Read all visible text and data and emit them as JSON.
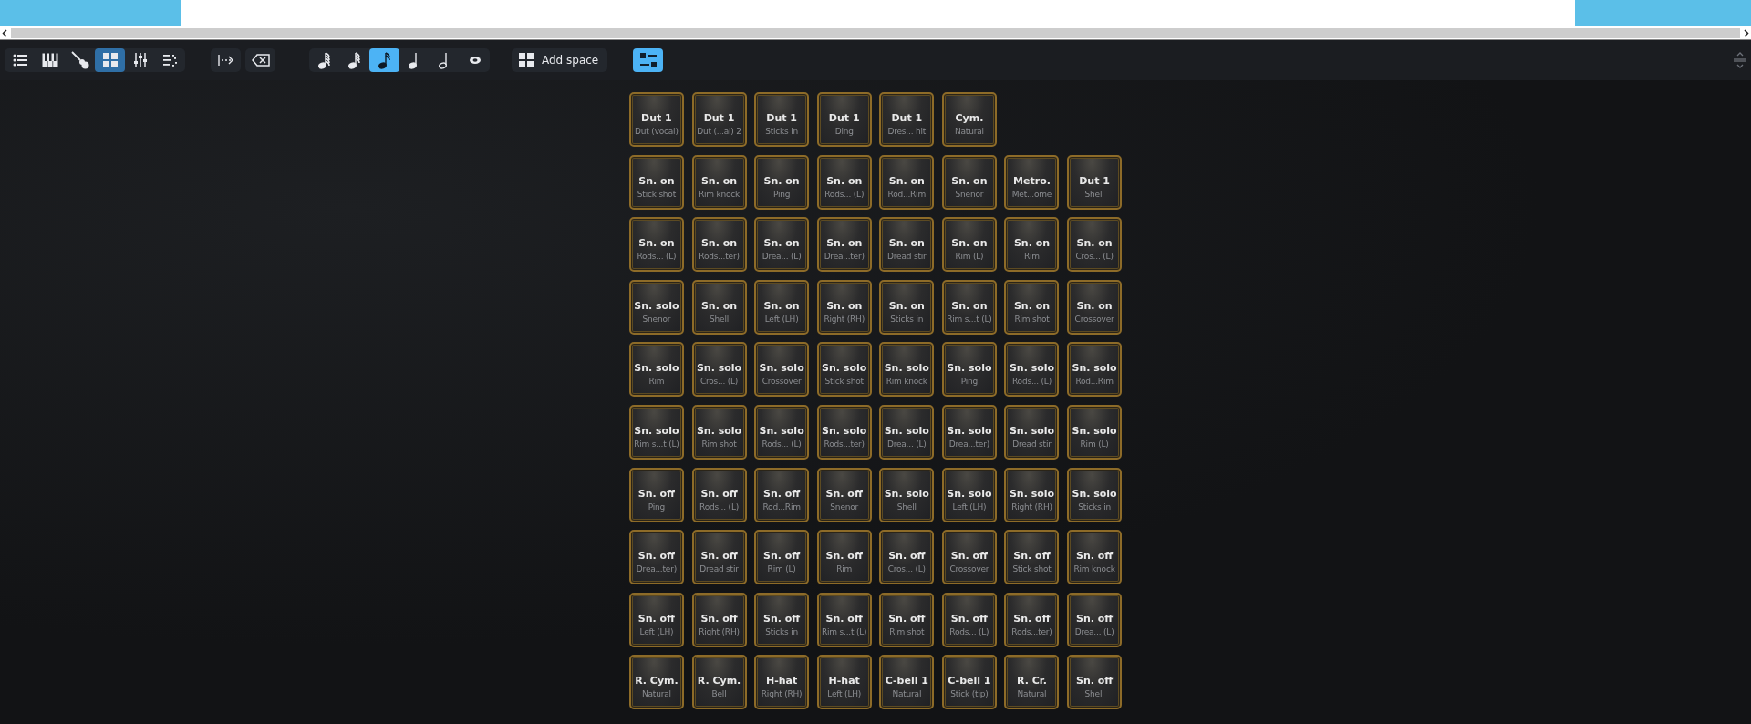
{
  "toolbar": {
    "groups": [
      {
        "items": [
          {
            "kind": "list",
            "selected": false
          },
          {
            "kind": "piano",
            "selected": false
          },
          {
            "kind": "guitar",
            "selected": false
          },
          {
            "kind": "grid",
            "selected": true
          },
          {
            "kind": "mixer",
            "selected": false
          },
          {
            "kind": "tracks",
            "selected": false
          }
        ]
      },
      {
        "items": [
          {
            "kind": "insert",
            "selected": false
          }
        ]
      },
      {
        "items": [
          {
            "kind": "backspace",
            "selected": false
          }
        ]
      },
      {
        "items": [
          {
            "kind": "note64",
            "selected": false
          },
          {
            "kind": "note32",
            "selected": false
          },
          {
            "kind": "note16",
            "selected": true
          },
          {
            "kind": "note8",
            "selected": false
          },
          {
            "kind": "note4",
            "selected": false
          },
          {
            "kind": "note2",
            "selected": false
          }
        ]
      }
    ],
    "add_space": {
      "label": "Add space"
    },
    "toggle": {
      "selected": true
    }
  },
  "pad_rows": [
    [
      {
        "title": "Dut 1",
        "sub": "Dut (vocal)"
      },
      {
        "title": "Dut 1",
        "sub": "Dut (...al) 2"
      },
      {
        "title": "Dut 1",
        "sub": "Sticks in"
      },
      {
        "title": "Dut 1",
        "sub": "Ding"
      },
      {
        "title": "Dut 1",
        "sub": "Dres... hit"
      },
      {
        "title": "Cym.",
        "sub": "Natural"
      }
    ],
    [
      {
        "title": "Sn. on",
        "sub": "Stick shot"
      },
      {
        "title": "Sn. on",
        "sub": "Rim knock"
      },
      {
        "title": "Sn. on",
        "sub": "Ping"
      },
      {
        "title": "Sn. on",
        "sub": "Rods... (L)"
      },
      {
        "title": "Sn. on",
        "sub": "Rod...Rim"
      },
      {
        "title": "Sn. on",
        "sub": "Snenor"
      },
      {
        "title": "Metro.",
        "sub": "Met...ome"
      },
      {
        "title": "Dut 1",
        "sub": "Shell"
      }
    ],
    [
      {
        "title": "Sn. on",
        "sub": "Rods... (L)"
      },
      {
        "title": "Sn. on",
        "sub": "Rods...ter)"
      },
      {
        "title": "Sn. on",
        "sub": "Drea... (L)"
      },
      {
        "title": "Sn. on",
        "sub": "Drea...ter)"
      },
      {
        "title": "Sn. on",
        "sub": "Dread stir"
      },
      {
        "title": "Sn. on",
        "sub": "Rim (L)"
      },
      {
        "title": "Sn. on",
        "sub": "Rim"
      },
      {
        "title": "Sn. on",
        "sub": "Cros... (L)"
      }
    ],
    [
      {
        "title": "Sn. solo",
        "sub": "Snenor"
      },
      {
        "title": "Sn. on",
        "sub": "Shell"
      },
      {
        "title": "Sn. on",
        "sub": "Left (LH)"
      },
      {
        "title": "Sn. on",
        "sub": "Right (RH)"
      },
      {
        "title": "Sn. on",
        "sub": "Sticks in"
      },
      {
        "title": "Sn. on",
        "sub": "Rim s...t (L)"
      },
      {
        "title": "Sn. on",
        "sub": "Rim shot"
      },
      {
        "title": "Sn. on",
        "sub": "Crossover"
      }
    ],
    [
      {
        "title": "Sn. solo",
        "sub": "Rim"
      },
      {
        "title": "Sn. solo",
        "sub": "Cros... (L)"
      },
      {
        "title": "Sn. solo",
        "sub": "Crossover"
      },
      {
        "title": "Sn. solo",
        "sub": "Stick shot"
      },
      {
        "title": "Sn. solo",
        "sub": "Rim knock"
      },
      {
        "title": "Sn. solo",
        "sub": "Ping"
      },
      {
        "title": "Sn. solo",
        "sub": "Rods... (L)"
      },
      {
        "title": "Sn. solo",
        "sub": "Rod...Rim"
      }
    ],
    [
      {
        "title": "Sn. solo",
        "sub": "Rim s...t (L)"
      },
      {
        "title": "Sn. solo",
        "sub": "Rim shot"
      },
      {
        "title": "Sn. solo",
        "sub": "Rods... (L)"
      },
      {
        "title": "Sn. solo",
        "sub": "Rods...ter)"
      },
      {
        "title": "Sn. solo",
        "sub": "Drea... (L)"
      },
      {
        "title": "Sn. solo",
        "sub": "Drea...ter)"
      },
      {
        "title": "Sn. solo",
        "sub": "Dread stir"
      },
      {
        "title": "Sn. solo",
        "sub": "Rim (L)"
      }
    ],
    [
      {
        "title": "Sn. off",
        "sub": "Ping"
      },
      {
        "title": "Sn. off",
        "sub": "Rods... (L)"
      },
      {
        "title": "Sn. off",
        "sub": "Rod...Rim"
      },
      {
        "title": "Sn. off",
        "sub": "Snenor"
      },
      {
        "title": "Sn. solo",
        "sub": "Shell"
      },
      {
        "title": "Sn. solo",
        "sub": "Left (LH)"
      },
      {
        "title": "Sn. solo",
        "sub": "Right (RH)"
      },
      {
        "title": "Sn. solo",
        "sub": "Sticks in"
      }
    ],
    [
      {
        "title": "Sn. off",
        "sub": "Drea...ter)"
      },
      {
        "title": "Sn. off",
        "sub": "Dread stir"
      },
      {
        "title": "Sn. off",
        "sub": "Rim (L)"
      },
      {
        "title": "Sn. off",
        "sub": "Rim"
      },
      {
        "title": "Sn. off",
        "sub": "Cros... (L)"
      },
      {
        "title": "Sn. off",
        "sub": "Crossover"
      },
      {
        "title": "Sn. off",
        "sub": "Stick shot"
      },
      {
        "title": "Sn. off",
        "sub": "Rim knock"
      }
    ],
    [
      {
        "title": "Sn. off",
        "sub": "Left (LH)"
      },
      {
        "title": "Sn. off",
        "sub": "Right (RH)"
      },
      {
        "title": "Sn. off",
        "sub": "Sticks in"
      },
      {
        "title": "Sn. off",
        "sub": "Rim s...t (L)"
      },
      {
        "title": "Sn. off",
        "sub": "Rim shot"
      },
      {
        "title": "Sn. off",
        "sub": "Rods... (L)"
      },
      {
        "title": "Sn. off",
        "sub": "Rods...ter)"
      },
      {
        "title": "Sn. off",
        "sub": "Drea... (L)"
      }
    ],
    [
      {
        "title": "R. Cym.",
        "sub": "Natural"
      },
      {
        "title": "R. Cym.",
        "sub": "Bell"
      },
      {
        "title": "H-hat",
        "sub": "Right (RH)"
      },
      {
        "title": "H-hat",
        "sub": "Left (LH)"
      },
      {
        "title": "C-bell 1",
        "sub": "Natural"
      },
      {
        "title": "C-bell 1",
        "sub": "Stick (tip)"
      },
      {
        "title": "R. Cr.",
        "sub": "Natural"
      },
      {
        "title": "Sn. off",
        "sub": "Shell"
      }
    ]
  ]
}
